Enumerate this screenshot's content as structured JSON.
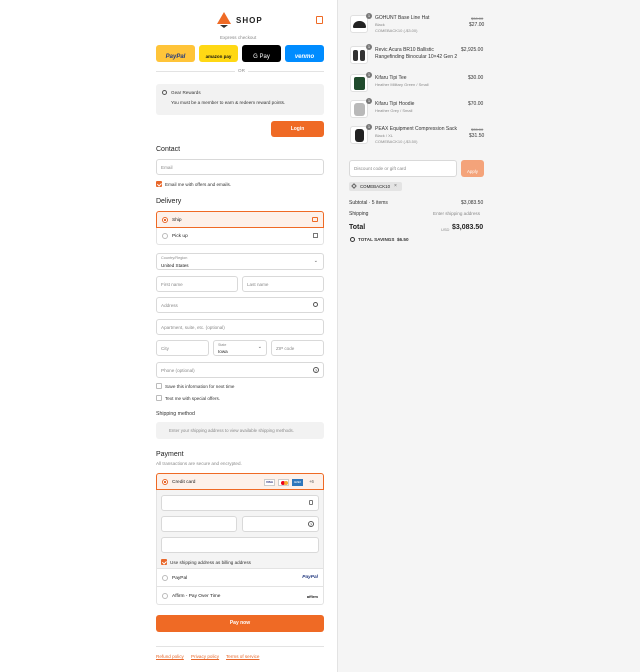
{
  "header": {
    "logo_text": "SHOP",
    "cart_icon": "bag-icon"
  },
  "express": {
    "label": "Express checkout",
    "paypal": "PayPal",
    "amazon": "amazon pay",
    "gpay": "G Pay",
    "venmo": "venmo",
    "or": "OR"
  },
  "rewards": {
    "title": "Gear Rewards",
    "message": "You must be a member to earn & redeem reward points.",
    "login": "Login"
  },
  "contact": {
    "heading": "Contact",
    "email_placeholder": "Email",
    "email_offers": "Email me with offers and emails."
  },
  "delivery": {
    "heading": "Delivery",
    "ship": "Ship",
    "pickup": "Pick up",
    "country_label": "Country/Region",
    "country_value": "United States",
    "first_name": "First name",
    "last_name": "Last name",
    "address": "Address",
    "apartment": "Apartment, suite, etc. (optional)",
    "city": "City",
    "state_label": "State",
    "state_value": "Iowa",
    "zip": "ZIP code",
    "phone": "Phone (optional)",
    "save_info": "Save this information for next time",
    "text_offers": "Text me with special offers."
  },
  "shipping_method": {
    "heading": "Shipping method",
    "note": "Enter your shipping address to view available shipping methods."
  },
  "payment": {
    "heading": "Payment",
    "sub": "All transactions are secure and encrypted.",
    "credit_card": "Credit card",
    "card_badges": [
      "VISA",
      "MC",
      "AMEX",
      "+6"
    ],
    "use_shipping": "Use shipping address as billing address",
    "paypal": "PayPal",
    "paypal_logo": "PayPal",
    "affirm": "Affirm - Pay Over Time",
    "affirm_logo": "affirm",
    "pay_now": "Pay now"
  },
  "footer": {
    "refund": "Refund policy",
    "privacy": "Privacy policy",
    "terms": "Terms of service"
  },
  "order": {
    "items": [
      {
        "qty": "1",
        "name": "GOHUNT Base Line Hat",
        "variant": "Black",
        "discount": "COMEBACK10 (-$3.00)",
        "orig": "$30.00",
        "price": "$27.00"
      },
      {
        "qty": "1",
        "name": "Revic Acura BR10 Ballistic",
        "name2": "Rangefinding Binocular 10×42 Gen 2",
        "variant": "",
        "discount": "",
        "orig": "",
        "price": "$2,925.00"
      },
      {
        "qty": "1",
        "name": "Kifaru Tipi Tee",
        "variant": "Heather Military Green / Small",
        "discount": "",
        "orig": "",
        "price": "$30.00"
      },
      {
        "qty": "1",
        "name": "Kifaru Tipi Hoodie",
        "variant": "Heather Grey / Small",
        "discount": "",
        "orig": "",
        "price": "$70.00"
      },
      {
        "qty": "1",
        "name": "PEAX Equipment Compression Sack",
        "variant": "Black / XL",
        "discount": "COMEBACK10 (-$3.50)",
        "orig": "$35.00",
        "price": "$31.50"
      }
    ],
    "discount_placeholder": "Discount code or gift card",
    "apply": "Apply",
    "applied_code": "COMEBACK10",
    "subtotal_label": "Subtotal · 5 items",
    "subtotal": "$3,083.50",
    "shipping_label": "Shipping",
    "shipping_value": "Enter shipping address",
    "total_label": "Total",
    "currency": "USD",
    "total": "$3,083.50",
    "savings_label": "TOTAL SAVINGS",
    "savings": "$6.50"
  }
}
